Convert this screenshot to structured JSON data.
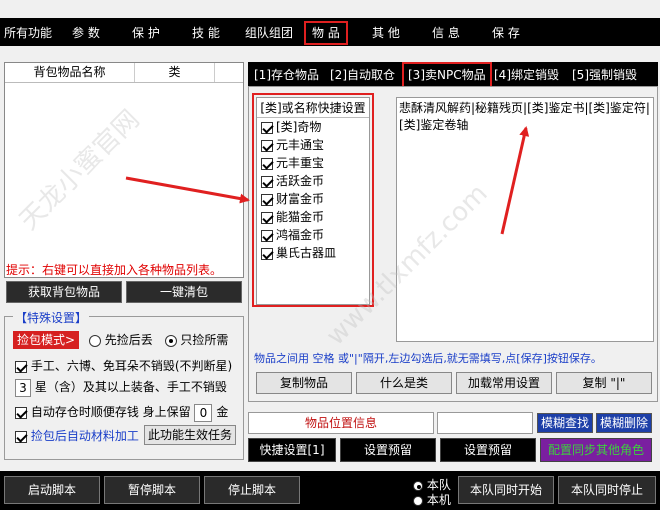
{
  "menu": [
    "所有功能",
    "参 数",
    "保 护",
    "技 能",
    "组队组团",
    "物 品",
    "其 他",
    "信 息",
    "保 存"
  ],
  "left": {
    "col_name": "背包物品名称",
    "col_type": "类",
    "hint": "提示：右键可以直接加入各种物品列表。",
    "btn_get": "获取背包物品",
    "btn_clear": "一键清包"
  },
  "special": {
    "title": "【特殊设置】",
    "pickup_mode": "捡包模式>",
    "opt1": "先捡后丢",
    "opt2": "只捡所需",
    "line2": "手工、六博、免耳朵不销毁(不判断星)",
    "star_value": "3",
    "line3": "星（含）及其以上装备、手工不销毁",
    "line4a": "自动存仓时顺便存钱 身上保留",
    "keep_value": "0",
    "line4b": "金",
    "line5": "捡包后自动材料加工",
    "btn_task": "此功能生效任务"
  },
  "tabs": [
    "[1]存仓物品",
    "[2]自动取仓",
    "[3]卖NPC物品",
    "[4]绑定销毁",
    "[5]强制销毁"
  ],
  "catbox": {
    "head": "[类]或名称快捷设置",
    "items": [
      "[类]奇物",
      "元丰通宝",
      "元丰重宝",
      "活跃金币",
      "财富金币",
      "能猫金币",
      "鸿福金币",
      "巢氏古器皿"
    ]
  },
  "text_content": "悲酥清风解药|秘籍残页|[类]鉴定书|[类]鉴定符|[类]鉴定卷轴",
  "note": "物品之间用 空格 或\"|\"隔开,左边勾选后,就无需填写,点[保存]按钮保存。",
  "buttons": {
    "copy_item": "复制物品",
    "what_class": "什么是类",
    "load_common": "加载常用设置",
    "copy_bar": "复制 \"|\""
  },
  "position": {
    "label": "物品位置信息",
    "fuzzy_find": "模糊查找",
    "fuzzy_delete": "模糊删除"
  },
  "quick": {
    "quick_set": "快捷设置[1]",
    "preset1": "设置预留",
    "preset2": "设置预留",
    "sync": "配置同步其他角色"
  },
  "bottom": {
    "start": "启动脚本",
    "pause": "暂停脚本",
    "stop": "停止脚本",
    "radio1": "本队",
    "radio2": "本机",
    "team_start": "本队同时开始",
    "team_stop": "本队同时停止"
  },
  "watermark": [
    "天龙小蜜官网",
    "www.tlxmfz.com"
  ],
  "colors": {
    "accent_red": "#e02020",
    "blue_text": "#1a3ec8",
    "blue_button": "#1d3fa8",
    "purple_button": "#7a1fa0",
    "green_text": "#3dd03d"
  }
}
